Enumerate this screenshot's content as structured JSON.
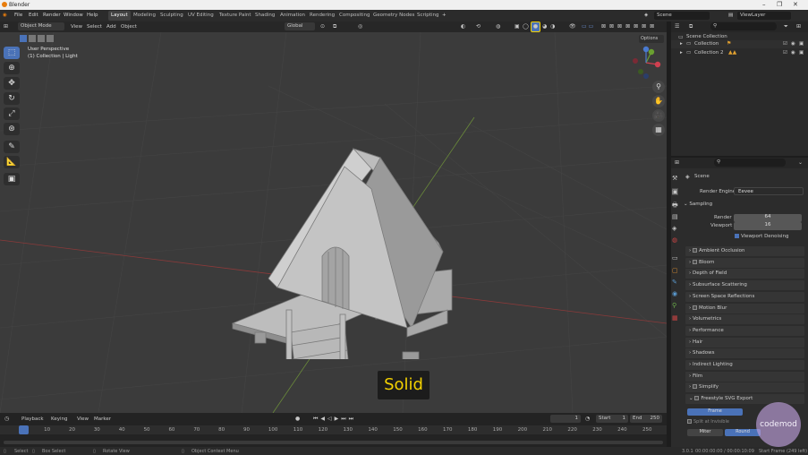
{
  "window": {
    "title": "Blender",
    "min": "–",
    "max": "❐",
    "close": "✕"
  },
  "menu": {
    "items": [
      "File",
      "Edit",
      "Render",
      "Window",
      "Help"
    ]
  },
  "workspaces": [
    "Layout",
    "Modeling",
    "Sculpting",
    "UV Editing",
    "Texture Paint",
    "Shading",
    "Animation",
    "Rendering",
    "Compositing",
    "Geometry Nodes",
    "Scripting"
  ],
  "scene": {
    "label": "Scene",
    "view_layer": "ViewLayer"
  },
  "header3d": {
    "mode": "Object Mode",
    "view": "View",
    "select": "Select",
    "add": "Add",
    "object": "Object",
    "orientation": "Global",
    "options": "Options"
  },
  "viewport": {
    "perspective": "User Perspective",
    "collection": "(1) Collection | Light",
    "overlay_text": "Solid"
  },
  "outliner": {
    "root": "Scene Collection",
    "items": [
      "Collection",
      "Collection 2"
    ]
  },
  "properties": {
    "scene": "Scene",
    "render_engine_label": "Render Engine",
    "render_engine": "Eevee",
    "sampling": "Sampling",
    "render_label": "Render",
    "render_value": "64",
    "viewport_label": "Viewport",
    "viewport_value": "16",
    "denoise": "Viewport Denoising",
    "panels": [
      "Ambient Occlusion",
      "Bloom",
      "Depth of Field",
      "Subsurface Scattering",
      "Screen Space Reflections",
      "Motion Blur",
      "Volumetrics",
      "Performance",
      "Hair",
      "Shadows",
      "Indirect Lighting",
      "Film",
      "Simplify",
      "Freestyle SVG Export"
    ],
    "frame_btn": "Frame",
    "split": "Split at Invisible",
    "miter": "Miter",
    "round": "Round"
  },
  "timeline": {
    "playback": "Playback",
    "keying": "Keying",
    "view": "View",
    "marker": "Marker",
    "current": "1",
    "start_label": "Start",
    "start": "1",
    "end_label": "End",
    "end": "250",
    "ticks": [
      "1",
      "10",
      "20",
      "30",
      "40",
      "50",
      "60",
      "70",
      "80",
      "90",
      "100",
      "110",
      "120",
      "130",
      "140",
      "150",
      "160",
      "170",
      "180",
      "190",
      "200",
      "210",
      "220",
      "230",
      "240",
      "250"
    ]
  },
  "status": {
    "select": "Select",
    "box": "Box Select",
    "rotate": "Rotate View",
    "context": "Object Context Menu",
    "version": "3.0.1",
    "time": "00:00:00:00 / 00:00:10:09",
    "start_frame": "Start Frame (249 left)"
  },
  "watermark": "codemod"
}
